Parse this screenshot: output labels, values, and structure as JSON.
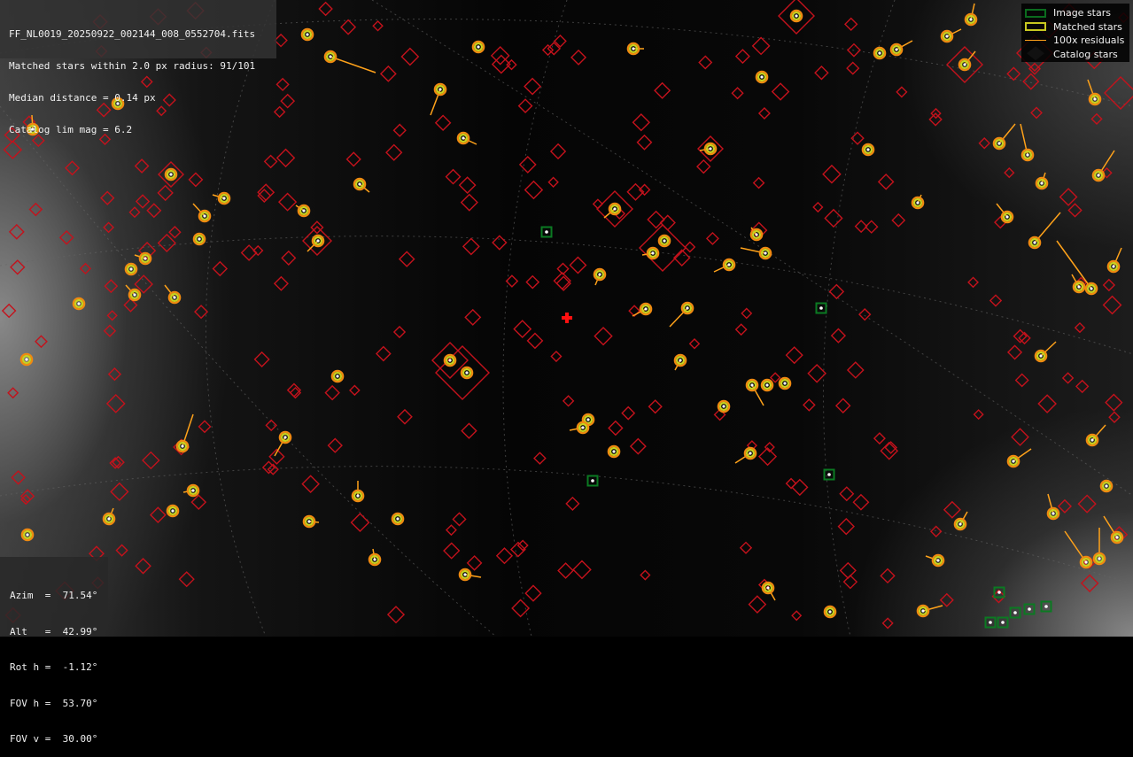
{
  "info": {
    "filename": "FF_NL0019_20250922_002144_008_0552704.fits",
    "matched_line": "Matched stars within 2.0 px radius: 91/101",
    "median_line": "Median distance = 0.14 px",
    "catalog_line": "Catalog lim mag = 6.2"
  },
  "legend": {
    "image_stars": "Image stars",
    "matched_stars": "Matched stars",
    "residuals": "100x residuals",
    "catalog_stars": "Catalog stars"
  },
  "pointing": {
    "azim": "Azim  =  71.54°",
    "alt": "Alt   =  42.99°",
    "roth": "Rot h =  -1.12°",
    "fovh": "FOV h =  53.70°",
    "fovv": "FOV v =  30.00°"
  },
  "colors": {
    "catalog": "#c4121c",
    "matched": "#c8d220",
    "image": "#0b7a22",
    "residual": "#ffa21a",
    "center_marker": "#ff1010"
  }
}
